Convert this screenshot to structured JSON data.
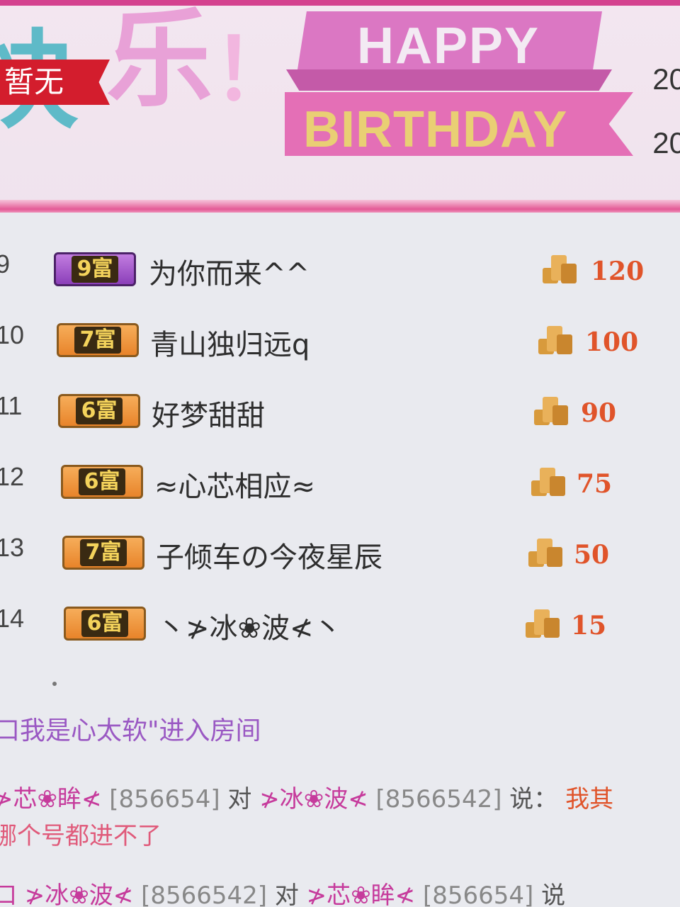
{
  "banner": {
    "title_chars": [
      "快",
      "乐",
      "！"
    ],
    "tag_label": "暂无",
    "happy": "HAPPY",
    "birthday": "BIRTHDAY",
    "years": [
      "20",
      "20"
    ]
  },
  "ranking": [
    {
      "rank": "9",
      "level": "9富",
      "badge_color": "#8b3fb9",
      "name": "为你而来^^",
      "coins": "120"
    },
    {
      "rank": "10",
      "level": "7富",
      "badge_color": "#e8842a",
      "name": "青山独归远q",
      "coins": "100"
    },
    {
      "rank": "11",
      "level": "6富",
      "badge_color": "#e8842a",
      "name": "好梦甜甜",
      "coins": "90"
    },
    {
      "rank": "12",
      "level": "6富",
      "badge_color": "#e8842a",
      "name": "≈心芯相应≈",
      "coins": "75"
    },
    {
      "rank": "13",
      "level": "7富",
      "badge_color": "#e8842a",
      "name": "子倾车の今夜星辰",
      "coins": "50"
    },
    {
      "rank": "14",
      "level": "6富",
      "badge_color": "#e8842a",
      "name": "丶≯冰❀波≮丶",
      "coins": "15"
    }
  ],
  "icons": {
    "coin": "gold-coin-stack-icon"
  },
  "chat": {
    "enter_message": "口我是心太软\"进入房间",
    "line1": {
      "from": "≯芯❀眸≮",
      "from_id": "[856654]",
      "to_word": "对",
      "to": "≯冰❀波≮",
      "to_id": "[8566542]",
      "say_word": "说：",
      "message": "我其"
    },
    "line2": "哪个号都进不了",
    "line3": {
      "from": "口 ≯冰❀波≮",
      "from_id": "[8566542]",
      "to_word": "对",
      "to": "≯芯❀眸≮",
      "to_id": "[856654]",
      "say_word": "说"
    }
  },
  "colors": {
    "accent_pink": "#d4428f",
    "coin_text": "#e0542a",
    "nick": "#c63b9c"
  }
}
